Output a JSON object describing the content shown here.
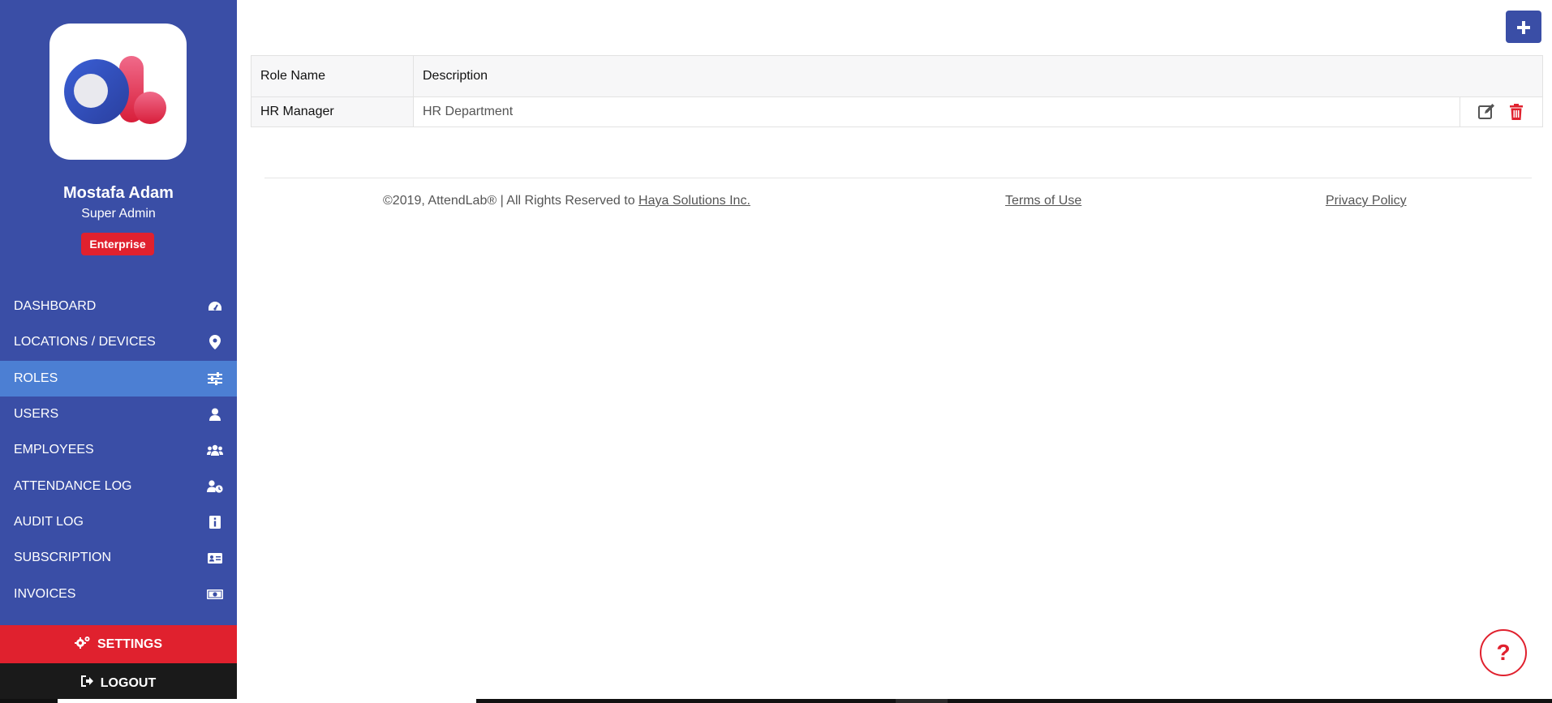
{
  "user": {
    "name": "Mostafa Adam",
    "role": "Super Admin",
    "plan": "Enterprise"
  },
  "sidebar": {
    "items": [
      {
        "label": "DASHBOARD",
        "icon": "dashboard-gauge-icon"
      },
      {
        "label": "LOCATIONS / DEVICES",
        "icon": "map-pin-icon"
      },
      {
        "label": "ROLES",
        "icon": "sliders-icon",
        "active": true
      },
      {
        "label": "USERS",
        "icon": "user-icon"
      },
      {
        "label": "EMPLOYEES",
        "icon": "users-group-icon"
      },
      {
        "label": "ATTENDANCE LOG",
        "icon": "user-clock-icon"
      },
      {
        "label": "AUDIT LOG",
        "icon": "info-icon"
      },
      {
        "label": "SUBSCRIPTION",
        "icon": "id-card-icon"
      },
      {
        "label": "INVOICES",
        "icon": "money-bill-icon"
      }
    ],
    "settings_label": "SETTINGS",
    "logout_label": "LOGOUT"
  },
  "table": {
    "headers": [
      "Role Name",
      "Description"
    ],
    "rows": [
      {
        "name": "HR Manager",
        "description": "HR Department"
      }
    ]
  },
  "footer": {
    "copyright_prefix": "©2019, AttendLab® | All Rights Reserved to",
    "company": "Haya Solutions Inc.",
    "terms": "Terms of Use",
    "privacy": "Privacy Policy"
  },
  "help_label": "?",
  "colors": {
    "sidebar": "#3a4ea6",
    "active": "#4c7fd3",
    "accent_red": "#e0212e"
  }
}
